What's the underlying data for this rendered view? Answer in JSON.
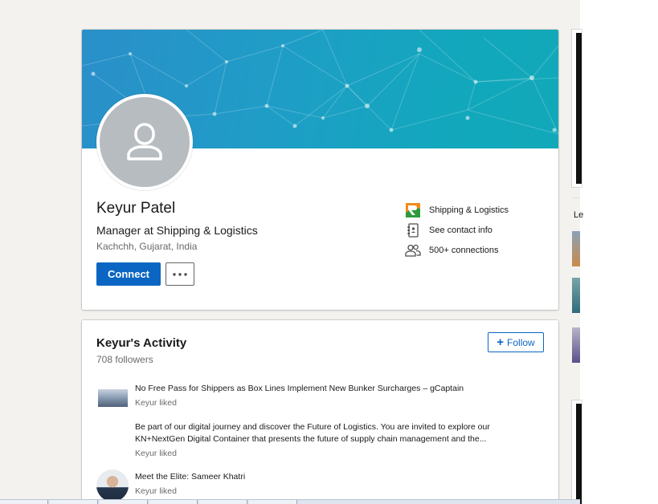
{
  "profile": {
    "name": "Keyur Patel",
    "headline": "Manager at Shipping & Logistics",
    "location": "Kachchh, Gujarat, India",
    "connect_label": "Connect",
    "more_icon": "ellipsis-icon",
    "info": {
      "company": "Shipping & Logistics",
      "contact": "See contact info",
      "connections": "500+ connections"
    }
  },
  "activity": {
    "title": "Keyur's Activity",
    "followers": "708 followers",
    "follow_label": "Follow",
    "items": [
      {
        "text": "No Free Pass for Shippers as Box Lines Implement New Bunker Surcharges – gCaptain",
        "sub": "Keyur liked"
      },
      {
        "text": "Be part of our digital journey and discover the Future of Logistics. You are invited to explore our KN+NextGen Digital Container that presents the future of supply chain management and the...",
        "sub": "Keyur liked"
      },
      {
        "text": "Meet the Elite: Sameer Khatri",
        "sub": "Keyur liked"
      }
    ]
  },
  "sidebar": {
    "letter": "Le"
  },
  "colors": {
    "primary": "#0a66c2",
    "page_bg": "#f3f2ef",
    "banner": "#1f9dc7"
  }
}
